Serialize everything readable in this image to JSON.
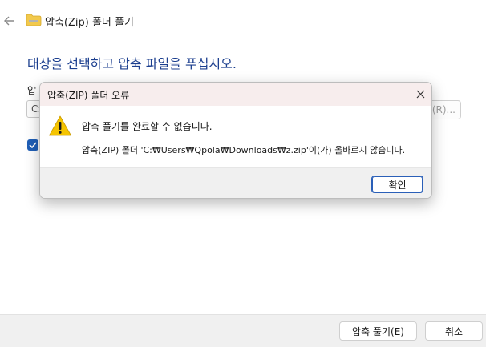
{
  "wizard": {
    "title": "압축(Zip) 폴더 풀기",
    "heading": "대상을 선택하고 압축 파일을 푸십시오.",
    "dest_label_partial": "압",
    "dest_input_partial": "C:",
    "browse_partial": "(R)...",
    "extract_button": "압축 풀기(E)",
    "cancel_button": "취소"
  },
  "dialog": {
    "title": "압축(ZIP) 폴더 오류",
    "message_main": "압축 풀기를 완료할 수 없습니다.",
    "message_detail": "압축(ZIP) 폴더 'C:₩Users₩Qpola₩Downloads₩z.zip'이(가) 올바르지 않습니다.",
    "ok_button": "확인"
  },
  "icons": {
    "back": "arrow-left-icon",
    "folder": "zip-folder-icon",
    "warning": "warning-icon",
    "close": "close-icon",
    "checkbox": "checkmark-icon"
  },
  "colors": {
    "heading": "#1c3f8f",
    "accent": "#1f5fb7",
    "dialog_titlebar": "#f7eded",
    "warning": "#f5c400"
  }
}
